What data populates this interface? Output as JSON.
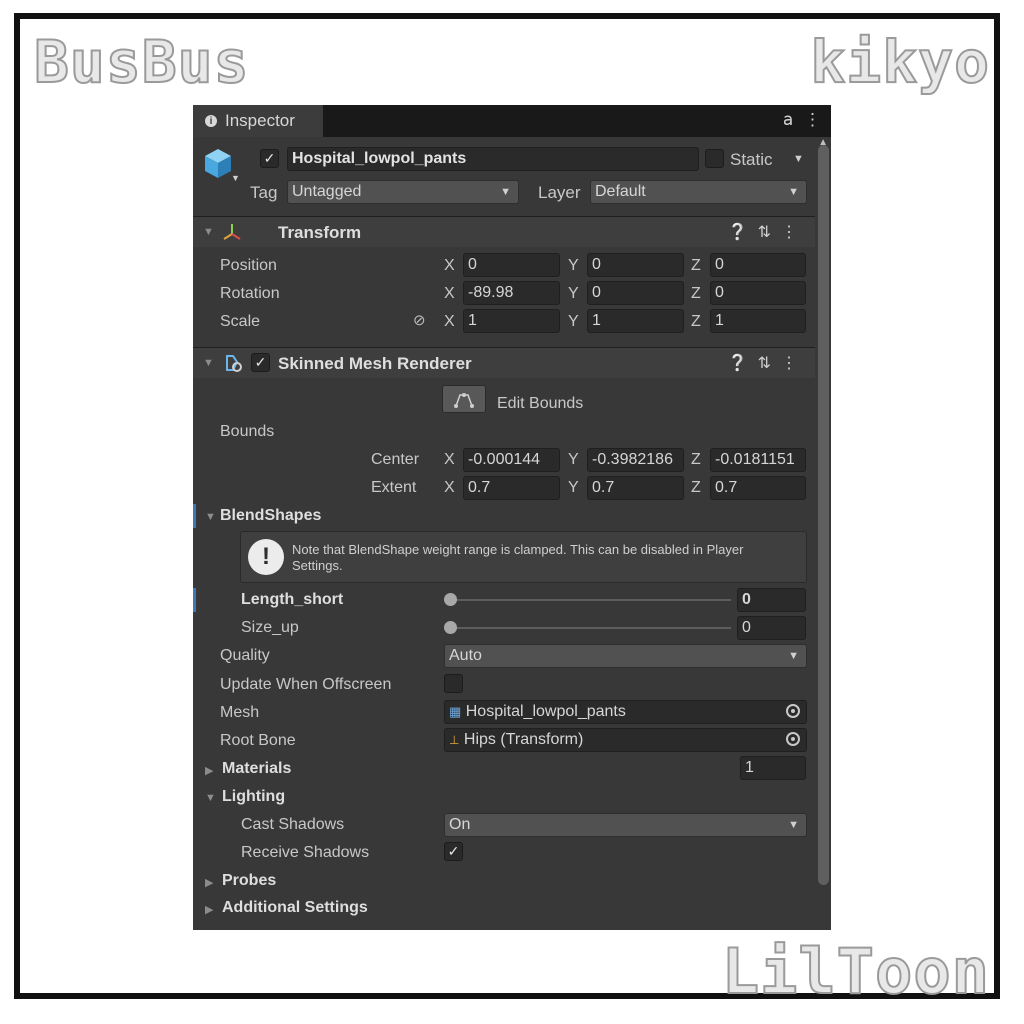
{
  "watermarks": {
    "top_left": "BusBus",
    "top_right": "kikyo",
    "bottom_right": "LilToon"
  },
  "tab": {
    "title": "Inspector",
    "lock_icon": "lock-icon",
    "menu_icon": "kebab-menu-icon"
  },
  "object": {
    "enabled": true,
    "name": "Hospital_lowpol_pants",
    "static_label": "Static",
    "static_checked": false,
    "tag_label": "Tag",
    "tag_value": "Untagged",
    "layer_label": "Layer",
    "layer_value": "Default",
    "icon": "cube-icon"
  },
  "transform": {
    "title": "Transform",
    "position_label": "Position",
    "rotation_label": "Rotation",
    "scale_label": "Scale",
    "position": {
      "x": "0",
      "y": "0",
      "z": "0"
    },
    "rotation": {
      "x": "-89.98",
      "y": "0",
      "z": "0"
    },
    "scale": {
      "x": "1",
      "y": "1",
      "z": "1"
    },
    "axis": {
      "x": "X",
      "y": "Y",
      "z": "Z"
    }
  },
  "renderer": {
    "title": "Skinned Mesh Renderer",
    "enabled": true,
    "edit_bounds_label": "Edit Bounds",
    "bounds_label": "Bounds",
    "center_label": "Center",
    "extent_label": "Extent",
    "center": {
      "x": "-0.000144",
      "y": "-0.3982186",
      "z": "-0.0181151"
    },
    "extent": {
      "x": "0.7",
      "y": "0.7",
      "z": "0.7"
    },
    "blendshapes_label": "BlendShapes",
    "note_text": "Note that BlendShape weight range is clamped. This can be disabled in Player Settings.",
    "blendshapes": [
      {
        "name": "Length_short",
        "value": "0",
        "fraction": 0
      },
      {
        "name": "Size_up",
        "value": "0",
        "fraction": 0
      }
    ],
    "quality_label": "Quality",
    "quality_value": "Auto",
    "update_offscreen_label": "Update When Offscreen",
    "update_offscreen_checked": false,
    "mesh_label": "Mesh",
    "mesh_value": "Hospital_lowpol_pants",
    "root_bone_label": "Root Bone",
    "root_bone_value": "Hips (Transform)",
    "materials_label": "Materials",
    "materials_count": "1",
    "lighting_label": "Lighting",
    "cast_shadows_label": "Cast Shadows",
    "cast_shadows_value": "On",
    "receive_shadows_label": "Receive Shadows",
    "receive_shadows_checked": true,
    "probes_label": "Probes",
    "additional_settings_label": "Additional Settings"
  },
  "colors": {
    "panel_bg": "#383838",
    "field_bg": "#2a2a2a",
    "accent_blue": "#3a79bb",
    "cube_icon": "#4aa8e0"
  }
}
